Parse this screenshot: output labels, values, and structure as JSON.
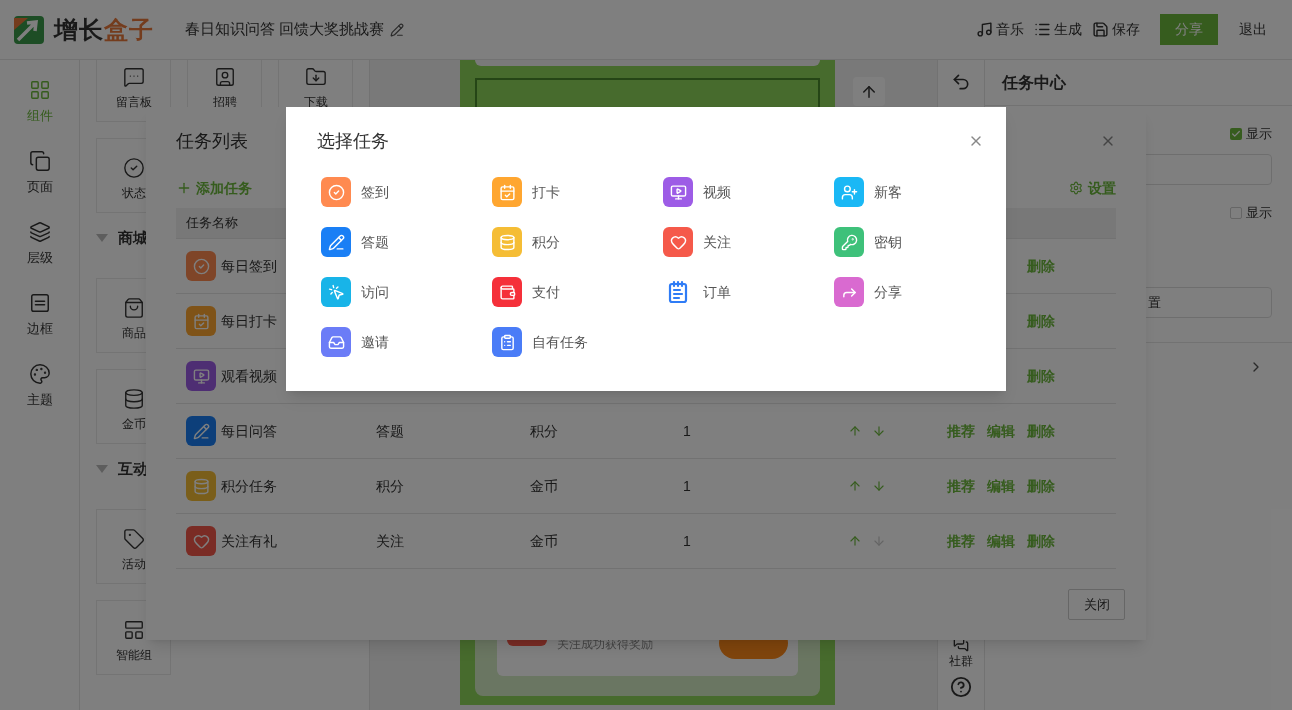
{
  "top_bar": {
    "brand": {
      "name": "增长",
      "accent": "盒子"
    },
    "project_title": "春日知识问答 回馈大奖挑战赛",
    "actions": [
      {
        "kind": "icon",
        "label": "音乐"
      },
      {
        "kind": "icon",
        "label": "生成"
      },
      {
        "kind": "icon",
        "label": "保存"
      },
      {
        "kind": "primary",
        "label": "分享"
      },
      {
        "kind": "plain",
        "label": "退出"
      }
    ]
  },
  "sidebar": {
    "items": [
      {
        "label": "组件",
        "selected": true
      },
      {
        "label": "页面",
        "selected": false
      },
      {
        "label": "层级",
        "selected": false
      },
      {
        "label": "边框",
        "selected": false
      },
      {
        "label": "主题",
        "selected": false
      }
    ]
  },
  "components": [
    {
      "kind": "tiles",
      "tiles": [
        {
          "label": "留言板"
        },
        {
          "label": "招聘"
        },
        {
          "label": "下载"
        }
      ]
    },
    {
      "kind": "tiles",
      "tiles": [
        {
          "label": "状态"
        }
      ]
    },
    {
      "kind": "section",
      "title": "商城",
      "expanded": true
    },
    {
      "kind": "tiles",
      "tiles": [
        {
          "label": "商品"
        }
      ]
    },
    {
      "kind": "tiles",
      "tiles": [
        {
          "label": "金币"
        }
      ]
    },
    {
      "kind": "section",
      "title": "互动",
      "expanded": true
    },
    {
      "kind": "tiles",
      "tiles": [
        {
          "label": "活动"
        }
      ]
    },
    {
      "kind": "tiles",
      "tiles": [
        {
          "label": "智能组"
        }
      ]
    }
  ],
  "canvas": {
    "preview_item_text": "关注成功获得奖励"
  },
  "side_tools": {
    "community_label": "社群"
  },
  "properties_panel": {
    "title": "任务中心",
    "rows": [
      {
        "kind": "checkbox",
        "label": "显示",
        "checked": true
      },
      {
        "kind": "input"
      },
      {
        "kind": "checkbox",
        "label": "显示",
        "checked": false
      },
      {
        "kind": "button",
        "label": "置"
      },
      {
        "kind": "expander"
      }
    ]
  },
  "task_list_dialog": {
    "title": "任务列表",
    "add_label": "添加任务",
    "settings_label": "设置",
    "columns": [
      "任务名称"
    ],
    "rows": [
      {
        "name": "每日签到",
        "actions": [
          "删除"
        ]
      },
      {
        "name": "每日打卡",
        "actions": [
          "删除"
        ]
      },
      {
        "name": "观看视频",
        "actions": [
          "删除"
        ]
      },
      {
        "name": "每日问答",
        "type": "答题",
        "reward": "积分",
        "count": "1",
        "arrows": [
          {
            "disabled": false
          },
          {
            "disabled": false
          }
        ],
        "actions": [
          "推荐",
          "编辑",
          "删除"
        ]
      },
      {
        "name": "积分任务",
        "type": "积分",
        "reward": "金币",
        "count": "1",
        "arrows": [
          {
            "disabled": false
          },
          {
            "disabled": false
          }
        ],
        "actions": [
          "推荐",
          "编辑",
          "删除"
        ]
      },
      {
        "name": "关注有礼",
        "type": "关注",
        "reward": "金币",
        "count": "1",
        "arrows": [
          {
            "disabled": false
          },
          {
            "disabled": true
          }
        ],
        "actions": [
          "推荐",
          "编辑",
          "删除"
        ]
      }
    ],
    "close_label": "关闭"
  },
  "choose_task_dialog": {
    "title": "选择任务",
    "options": [
      {
        "label": "签到",
        "kind": "tile",
        "color": "#ff8a50"
      },
      {
        "label": "打卡",
        "kind": "tile",
        "color": "#ffa630"
      },
      {
        "label": "视频",
        "kind": "tile",
        "color": "#9d5ce6"
      },
      {
        "label": "新客",
        "kind": "tile",
        "color": "#1ab8f5"
      },
      {
        "label": "答题",
        "kind": "tile",
        "color": "#1a7ff5"
      },
      {
        "label": "积分",
        "kind": "tile",
        "color": "#f5bd35"
      },
      {
        "label": "关注",
        "kind": "tile",
        "color": "#f5594a"
      },
      {
        "label": "密钥",
        "kind": "tile",
        "color": "#3ec17a"
      },
      {
        "label": "访问",
        "kind": "tile",
        "color": "#18b4e8"
      },
      {
        "label": "支付",
        "kind": "tile",
        "color": "#f5303a"
      },
      {
        "label": "订单",
        "kind": "plain",
        "color": "#2f7cf6"
      },
      {
        "label": "分享",
        "kind": "tile",
        "color": "#d96ad0"
      },
      {
        "label": "邀请",
        "kind": "tile",
        "color": "#6b7cf7"
      },
      {
        "label": "自有任务",
        "kind": "tile",
        "color": "#4a7cf7"
      }
    ]
  }
}
